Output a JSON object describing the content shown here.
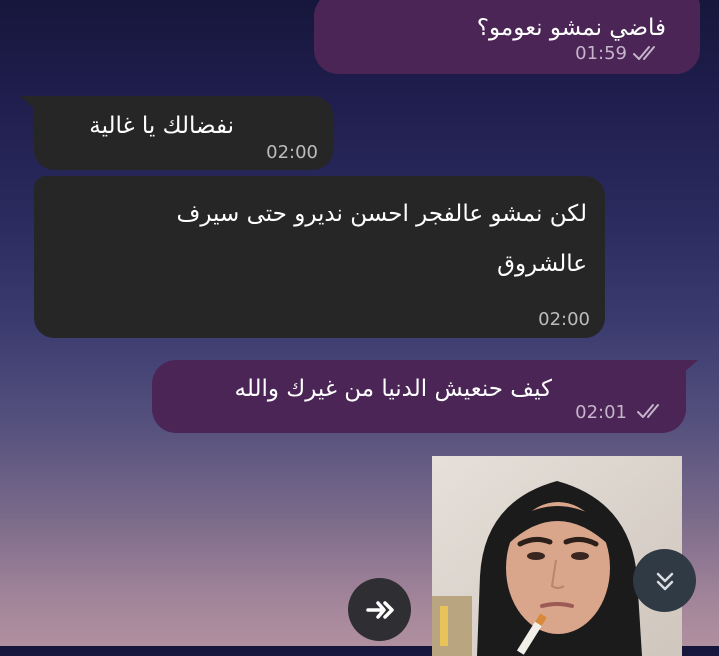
{
  "messages": [
    {
      "direction": "outgoing",
      "text": "فاضي نمشو نعومو؟",
      "time": "01:59",
      "status": "read"
    },
    {
      "direction": "incoming",
      "text": "نفضالك يا غالية",
      "time": "02:00"
    },
    {
      "direction": "incoming",
      "lines": [
        "لكن نمشو عالفجر احسن نديرو حتى سيرف",
        "عالشروق"
      ],
      "time": "02:00"
    },
    {
      "direction": "outgoing",
      "text": "كيف حنعيش الدنيا من غيرك والله",
      "time": "02:01",
      "status": "read"
    },
    {
      "direction": "outgoing",
      "type": "photo"
    }
  ],
  "icons": {
    "read_receipt": "double-check-icon",
    "forward": "forward-icon",
    "scroll_down": "chevron-double-down-icon"
  },
  "colors": {
    "outgoing_bubble": "#4a2555",
    "incoming_bubble": "#262626",
    "timestamp": "#bcbcbc",
    "background_top": "#17163c",
    "background_bottom": "#b0909f"
  }
}
